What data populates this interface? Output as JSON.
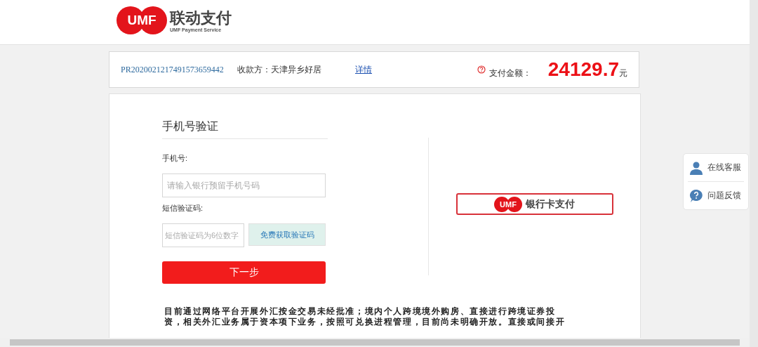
{
  "header": {
    "logo_badge": "UMF",
    "brand": "联动支付",
    "tagline": "UMF Payment Service"
  },
  "order": {
    "number": "PR2020021217491573659442",
    "payee": "收款方：天津异乡好居",
    "details_link": "详情",
    "amount_label": "支付金额：",
    "amount": "24129.7",
    "currency": "元"
  },
  "form": {
    "title": "手机号验证",
    "phone_label": "手机号:",
    "phone_placeholder": "请输入银行预留手机号码",
    "sms_label": "短信验证码:",
    "sms_placeholder": "短信验证码为6位数字",
    "sms_button": "免费获取验证码",
    "next_button": "下一步"
  },
  "bank_card": {
    "badge": "UMF",
    "label": "银行卡支付"
  },
  "notice_lines": [
    "目前通过网络平台开展外汇按金交易未经批准；境内个人跨境境外购房、直接进行跨境证券投",
    "资，相关外汇业务属于资本项下业务，按照可兑换进程管理，目前尚未明确开放。直接或间接开"
  ],
  "side_panel": [
    {
      "kind": "person",
      "label": "在线客服"
    },
    {
      "kind": "question",
      "label": "问题反馈"
    }
  ]
}
